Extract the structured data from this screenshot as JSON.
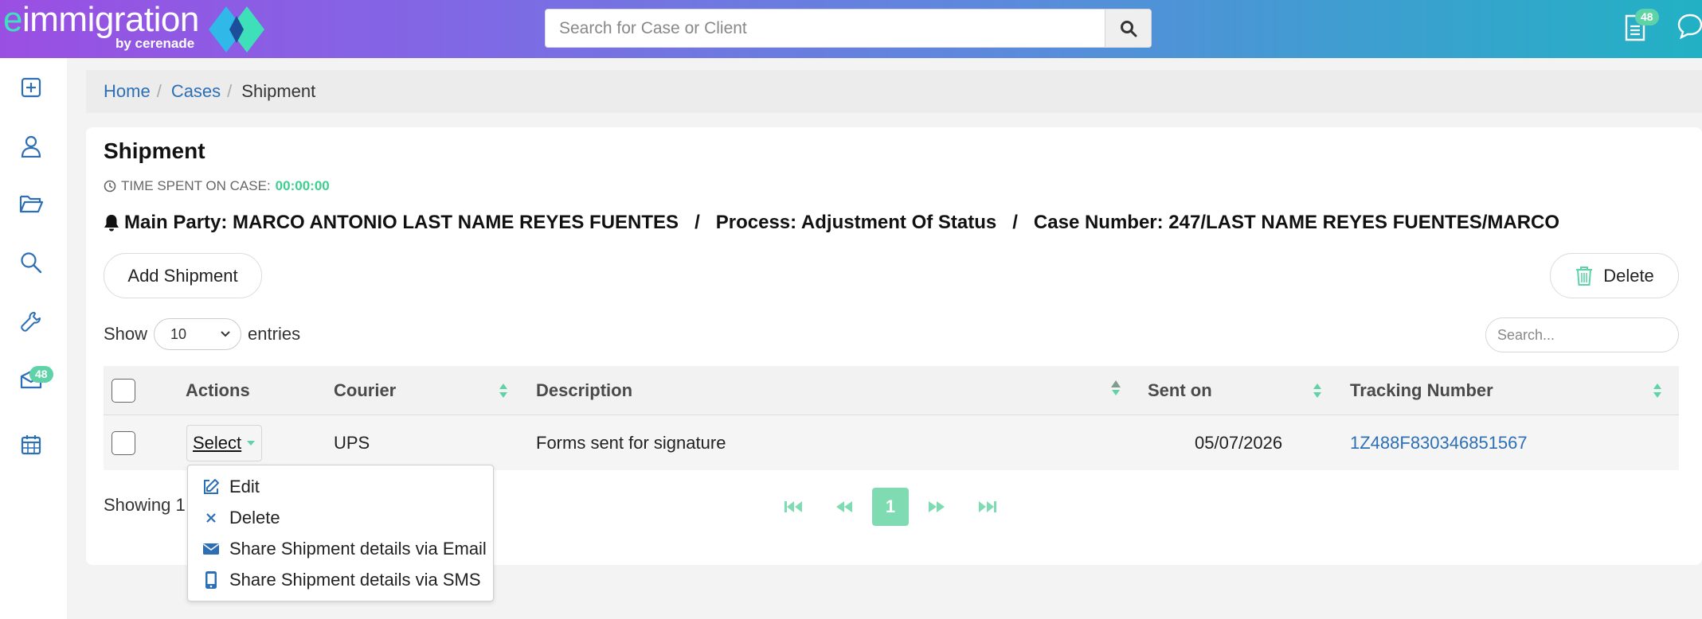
{
  "app": {
    "logo_text": "immigration",
    "logo_e": "e",
    "logo_sub": "by cerenade",
    "search_placeholder": "Search for Case or Client",
    "doc_badge": "48",
    "accent": "#5fd3a8"
  },
  "sidebar": {
    "items": [
      {
        "icon": "plus-square-icon"
      },
      {
        "icon": "user-icon"
      },
      {
        "icon": "folder-icon"
      },
      {
        "icon": "search-icon"
      },
      {
        "icon": "wrench-icon"
      },
      {
        "icon": "mail-icon",
        "badge": "48"
      },
      {
        "icon": "calendar-icon"
      }
    ]
  },
  "breadcrumb": {
    "home": "Home",
    "cases": "Cases",
    "current": "Shipment"
  },
  "page": {
    "title": "Shipment",
    "time_label": "TIME SPENT ON CASE:",
    "time_value": "00:00:00",
    "party": "Main Party: MARCO ANTONIO LAST NAME REYES FUENTES",
    "process": "Process: Adjustment Of Status",
    "case_number": "Case Number: 247/LAST NAME REYES FUENTES/MARCO",
    "slash": "/",
    "add_button": "Add Shipment",
    "delete_button": "Delete"
  },
  "table": {
    "show_label": "Show",
    "entries_value": "10",
    "entries_label": "entries",
    "search_placeholder": "Search...",
    "headers": {
      "actions": "Actions",
      "courier": "Courier",
      "description": "Description",
      "sent_on": "Sent on",
      "tracking": "Tracking Number"
    },
    "rows": [
      {
        "select": "Select",
        "courier": "UPS",
        "description": "Forms sent for signature",
        "sent_on": "05/07/2026",
        "tracking": "1Z488F830346851567"
      }
    ],
    "showing": "Showing 1",
    "current_page": "1"
  },
  "action_menu": {
    "edit": "Edit",
    "delete": "Delete",
    "email": "Share Shipment details via Email",
    "sms": "Share Shipment details via SMS"
  }
}
